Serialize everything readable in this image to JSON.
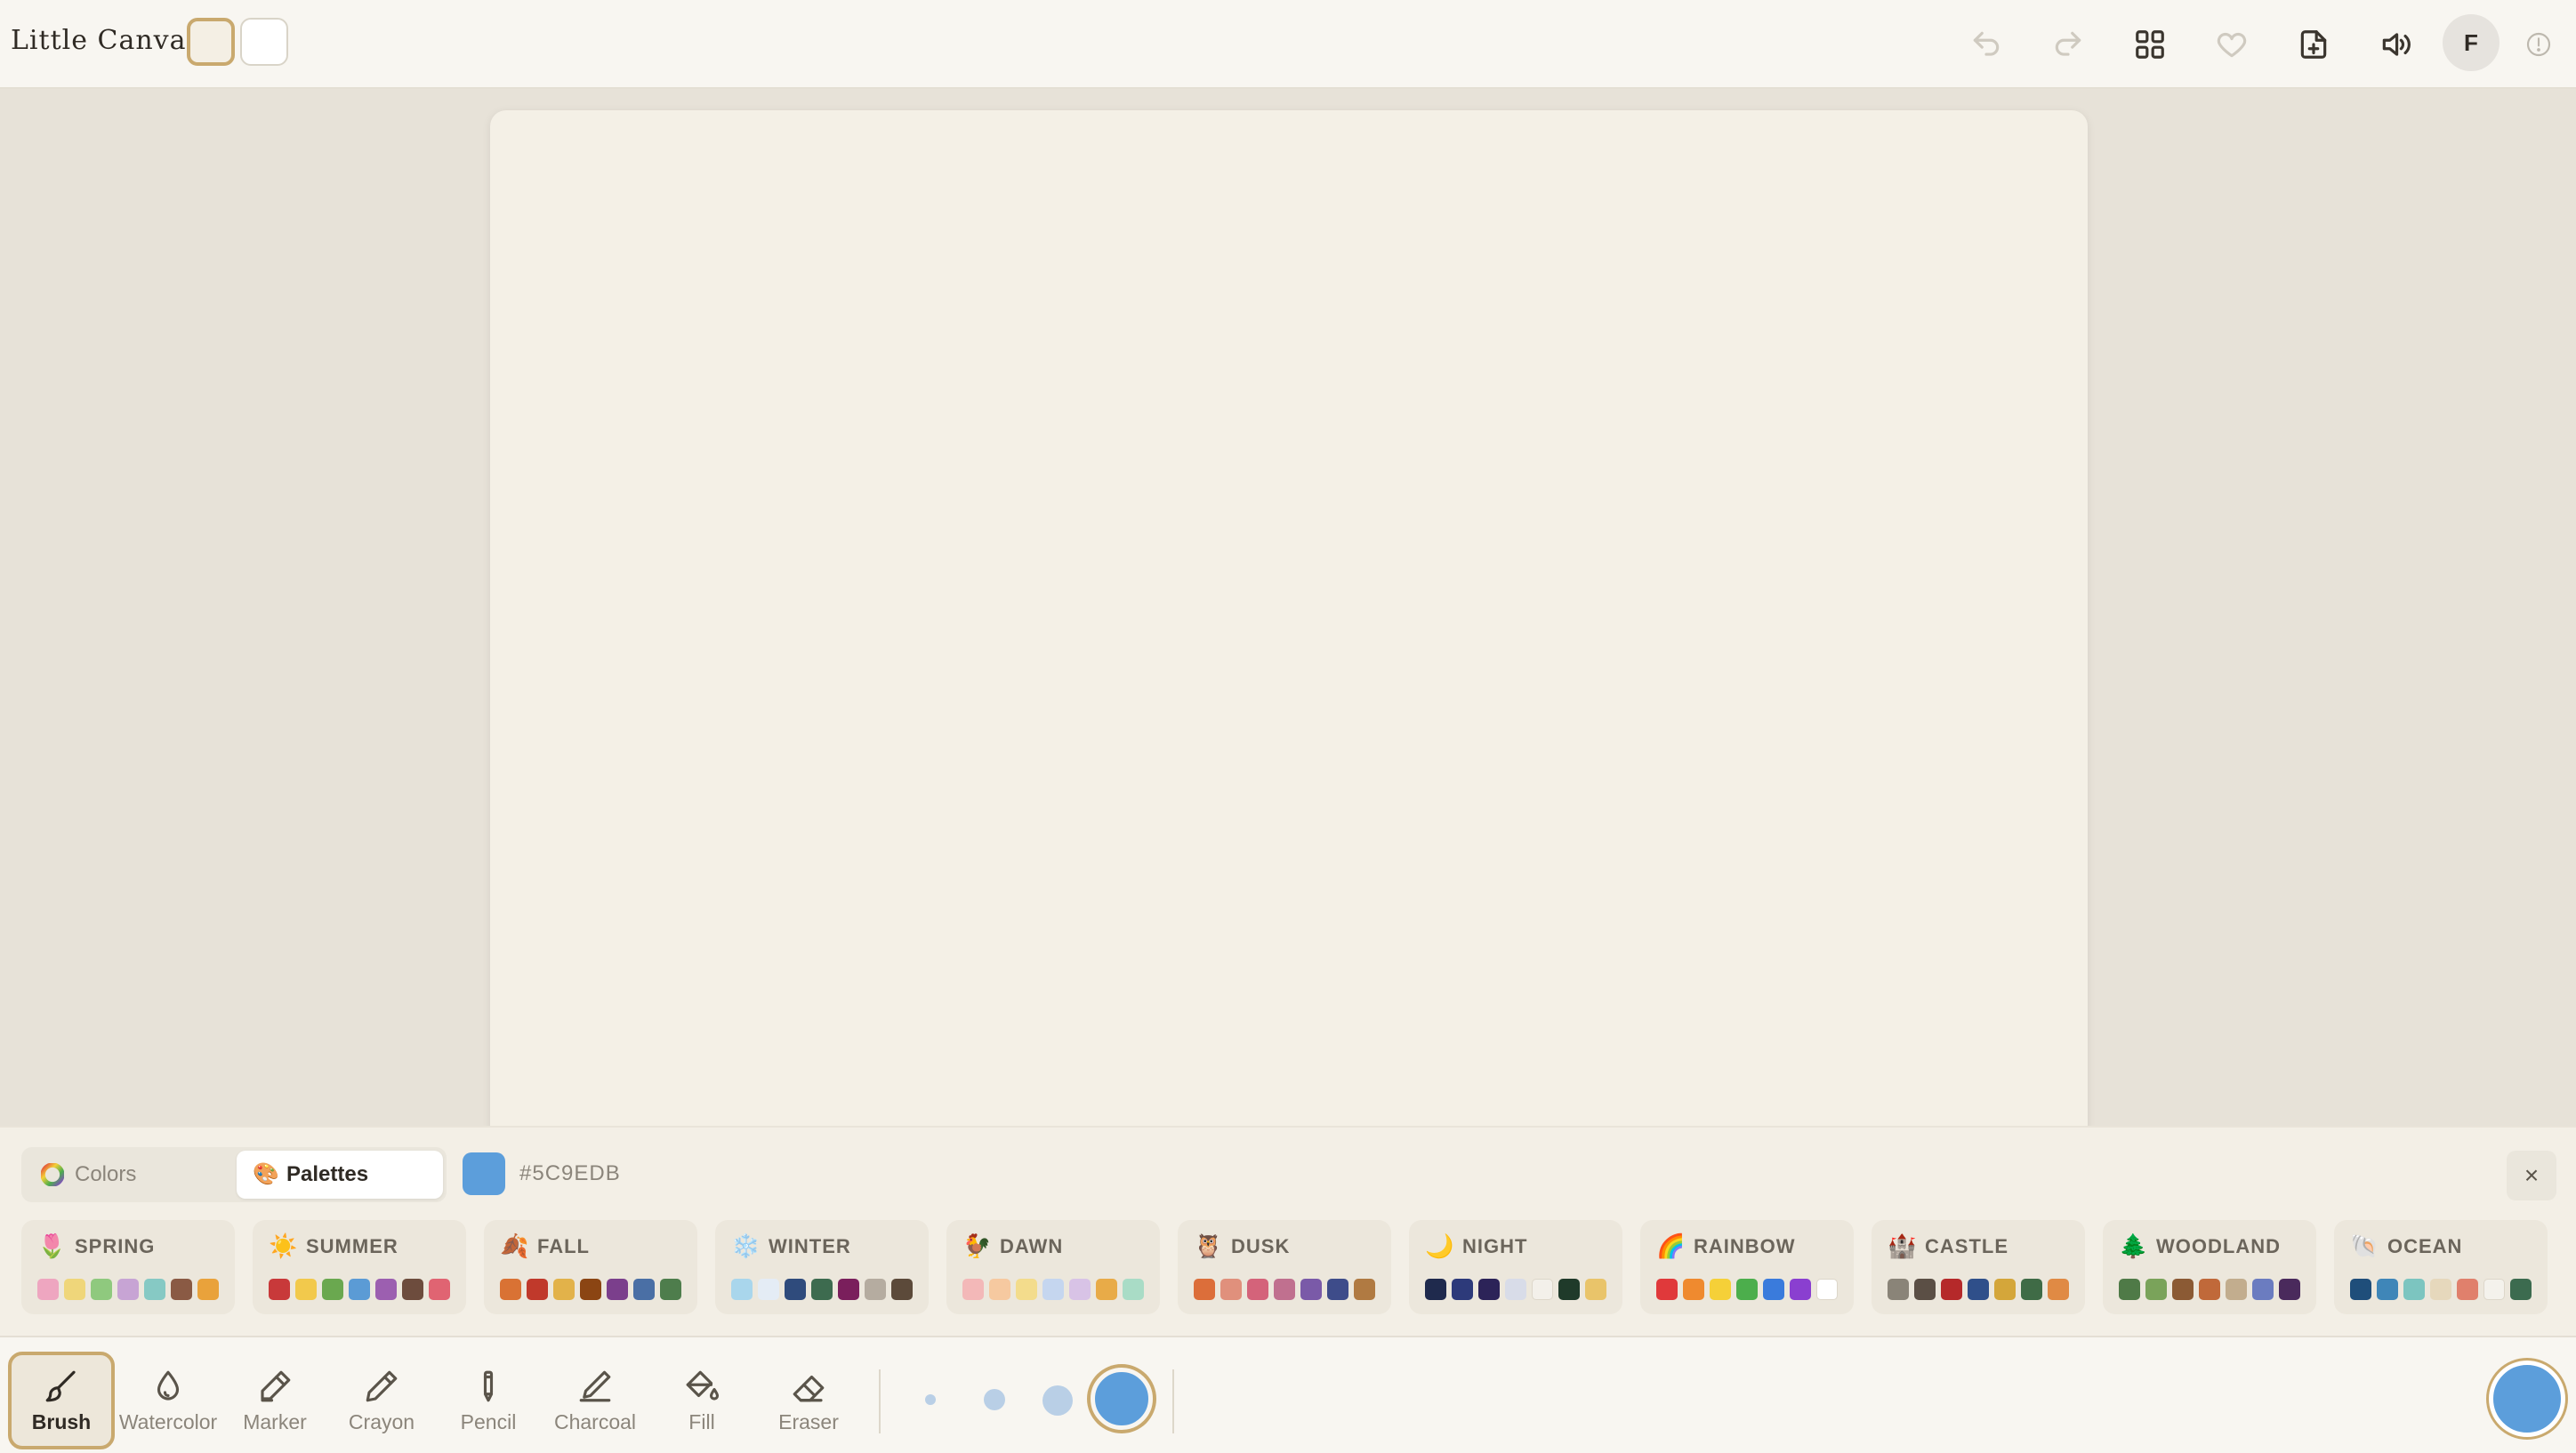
{
  "app": {
    "title": "Little Canvas"
  },
  "header": {
    "background_options": [
      {
        "name": "cream",
        "color": "#f4efe4",
        "selected": true
      },
      {
        "name": "white",
        "color": "#ffffff",
        "selected": false
      }
    ],
    "actions": [
      "undo-icon",
      "redo-icon",
      "gallery-icon",
      "favorite-icon",
      "new-page-icon",
      "sound-icon"
    ],
    "avatar_initial": "F"
  },
  "panel": {
    "tabs": [
      {
        "label": "Colors",
        "icon": "color-wheel-icon",
        "selected": false
      },
      {
        "label": "Palettes",
        "icon": "palette-icon",
        "selected": true
      }
    ],
    "current_color": "#5c9edb",
    "current_hex": "#5C9EDB",
    "close_label": "×",
    "palettes": [
      {
        "name": "SPRING",
        "emoji": "🌷",
        "colors": [
          "#eea6c0",
          "#efd67a",
          "#8fc97e",
          "#c7a4d4",
          "#86c9c4",
          "#8a5a44",
          "#e9a23b"
        ]
      },
      {
        "name": "SUMMER",
        "emoji": "☀️",
        "colors": [
          "#c8393a",
          "#f2c94c",
          "#6aa84f",
          "#5b9bd5",
          "#9c5fb0",
          "#6d4c3d",
          "#e06472"
        ]
      },
      {
        "name": "FALL",
        "emoji": "🍂",
        "colors": [
          "#d97234",
          "#c0392b",
          "#e2b24a",
          "#8b4513",
          "#7b3f8c",
          "#4a6fa5",
          "#4e7d4c"
        ]
      },
      {
        "name": "WINTER",
        "emoji": "❄️",
        "colors": [
          "#a9d6ec",
          "#e4ecf5",
          "#2f4b7c",
          "#3d6b4f",
          "#7a1f5c",
          "#b5aca0",
          "#5c4a3a"
        ]
      },
      {
        "name": "DAWN",
        "emoji": "🐓",
        "colors": [
          "#f3b8b8",
          "#f6c9a0",
          "#f3dc8c",
          "#c5d6ef",
          "#d8c3e6",
          "#e8ab48",
          "#a9dcc6"
        ]
      },
      {
        "name": "DUSK",
        "emoji": "🦉",
        "colors": [
          "#dc6e3a",
          "#e0907c",
          "#d4637a",
          "#c0708f",
          "#7a5aa8",
          "#3e4c8a",
          "#b07a42"
        ]
      },
      {
        "name": "NIGHT",
        "emoji": "🌙",
        "colors": [
          "#1f2a4d",
          "#2d3a7a",
          "#2c2358",
          "#d8dce8",
          "#f3f0ea",
          "#1f3a2a",
          "#e9c46a"
        ]
      },
      {
        "name": "RAINBOW",
        "emoji": "🌈",
        "colors": [
          "#e0393b",
          "#ef8a2f",
          "#f5d038",
          "#4cae4c",
          "#3a7bdc",
          "#8a3fd0",
          "#ffffff"
        ]
      },
      {
        "name": "CASTLE",
        "emoji": "🏰",
        "colors": [
          "#8a8478",
          "#5b4f45",
          "#b5292a",
          "#2f4f8a",
          "#d4a63a",
          "#3f6b46",
          "#e08a44"
        ]
      },
      {
        "name": "WOODLAND",
        "emoji": "🌲",
        "colors": [
          "#4f7a47",
          "#7aa35a",
          "#8b5a34",
          "#c0693a",
          "#c2ad8e",
          "#6b7cc0",
          "#4a2a5c"
        ]
      },
      {
        "name": "OCEAN",
        "emoji": "🐚",
        "colors": [
          "#1f4e7a",
          "#3f86b8",
          "#7cc5c0",
          "#e6d8bc",
          "#e0806c",
          "#f4f2ec",
          "#3c6b4f"
        ]
      }
    ]
  },
  "toolbar": {
    "tools": [
      {
        "label": "Brush",
        "icon": "brush-icon",
        "active": true
      },
      {
        "label": "Watercolor",
        "icon": "water-drop-icon",
        "active": false
      },
      {
        "label": "Marker",
        "icon": "marker-icon",
        "active": false
      },
      {
        "label": "Crayon",
        "icon": "crayon-icon",
        "active": false
      },
      {
        "label": "Pencil",
        "icon": "pencil-icon",
        "active": false
      },
      {
        "label": "Charcoal",
        "icon": "charcoal-icon",
        "active": false
      },
      {
        "label": "Fill",
        "icon": "fill-bucket-icon",
        "active": false
      },
      {
        "label": "Eraser",
        "icon": "eraser-icon",
        "active": false
      }
    ],
    "brush_sizes": [
      "small",
      "medium",
      "large",
      "extra-large"
    ],
    "selected_size": "extra-large",
    "active_color": "#5c9edb"
  }
}
